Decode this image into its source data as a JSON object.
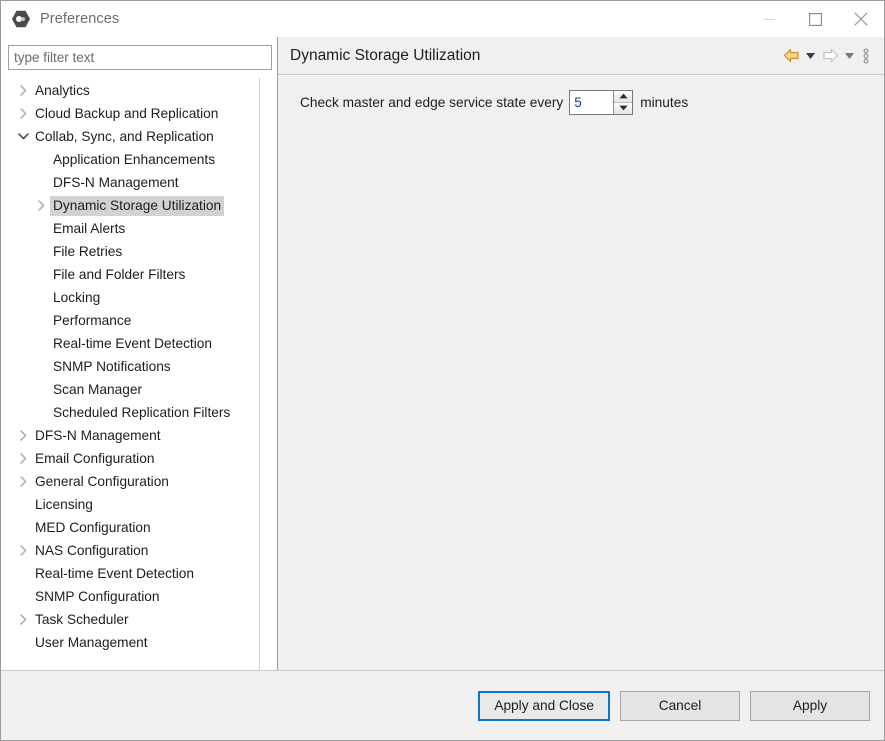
{
  "window": {
    "title": "Preferences",
    "app_icon": "preferences-hexagon-icon",
    "controls": {
      "minimize": "minimize-icon",
      "maximize": "maximize-icon",
      "close": "close-icon"
    }
  },
  "filter": {
    "placeholder": "type filter text",
    "value": ""
  },
  "tree": {
    "items": [
      {
        "label": "Analytics",
        "indent": 1,
        "twisty": "collapsed",
        "selected": false
      },
      {
        "label": "Cloud Backup and Replication",
        "indent": 1,
        "twisty": "collapsed",
        "selected": false
      },
      {
        "label": "Collab, Sync, and Replication",
        "indent": 1,
        "twisty": "expanded",
        "selected": false
      },
      {
        "label": "Application Enhancements",
        "indent": 2,
        "twisty": "none",
        "selected": false
      },
      {
        "label": "DFS-N Management",
        "indent": 2,
        "twisty": "none",
        "selected": false
      },
      {
        "label": "Dynamic Storage Utilization",
        "indent": 2,
        "twisty": "collapsed",
        "selected": true
      },
      {
        "label": "Email Alerts",
        "indent": 2,
        "twisty": "none",
        "selected": false
      },
      {
        "label": "File Retries",
        "indent": 2,
        "twisty": "none",
        "selected": false
      },
      {
        "label": "File and Folder Filters",
        "indent": 2,
        "twisty": "none",
        "selected": false
      },
      {
        "label": "Locking",
        "indent": 2,
        "twisty": "none",
        "selected": false
      },
      {
        "label": "Performance",
        "indent": 2,
        "twisty": "none",
        "selected": false
      },
      {
        "label": "Real-time Event Detection",
        "indent": 2,
        "twisty": "none",
        "selected": false
      },
      {
        "label": "SNMP Notifications",
        "indent": 2,
        "twisty": "none",
        "selected": false
      },
      {
        "label": "Scan Manager",
        "indent": 2,
        "twisty": "none",
        "selected": false
      },
      {
        "label": "Scheduled Replication Filters",
        "indent": 2,
        "twisty": "none",
        "selected": false
      },
      {
        "label": "DFS-N Management",
        "indent": 1,
        "twisty": "collapsed",
        "selected": false
      },
      {
        "label": "Email Configuration",
        "indent": 1,
        "twisty": "collapsed",
        "selected": false
      },
      {
        "label": "General Configuration",
        "indent": 1,
        "twisty": "collapsed",
        "selected": false
      },
      {
        "label": "Licensing",
        "indent": 1,
        "twisty": "none",
        "selected": false
      },
      {
        "label": "MED Configuration",
        "indent": 1,
        "twisty": "none",
        "selected": false
      },
      {
        "label": "NAS Configuration",
        "indent": 1,
        "twisty": "collapsed",
        "selected": false
      },
      {
        "label": "Real-time Event Detection",
        "indent": 1,
        "twisty": "none",
        "selected": false
      },
      {
        "label": "SNMP Configuration",
        "indent": 1,
        "twisty": "none",
        "selected": false
      },
      {
        "label": "Task Scheduler",
        "indent": 1,
        "twisty": "collapsed",
        "selected": false
      },
      {
        "label": "User Management",
        "indent": 1,
        "twisty": "none",
        "selected": false
      }
    ]
  },
  "page": {
    "title": "Dynamic Storage Utilization",
    "toolbar": {
      "back_icon": "back-arrow-icon",
      "back_dropdown_icon": "chevron-down-icon",
      "forward_icon": "forward-arrow-icon",
      "forward_dropdown_icon": "chevron-down-icon",
      "view_menu_icon": "vertical-dots-icon"
    },
    "settings": {
      "check_interval_prefix": "Check master and edge service state every",
      "check_interval_value": "5",
      "check_interval_suffix": "minutes"
    }
  },
  "footer": {
    "apply_and_close_label": "Apply and Close",
    "cancel_label": "Cancel",
    "apply_label": "Apply"
  },
  "colors": {
    "focus_border": "#0a74d1",
    "back_arrow": "#e8a93a",
    "forward_arrow": "#c9c9c9",
    "selection": "#d2d2d2",
    "panel_bg": "#f0f0f0"
  }
}
